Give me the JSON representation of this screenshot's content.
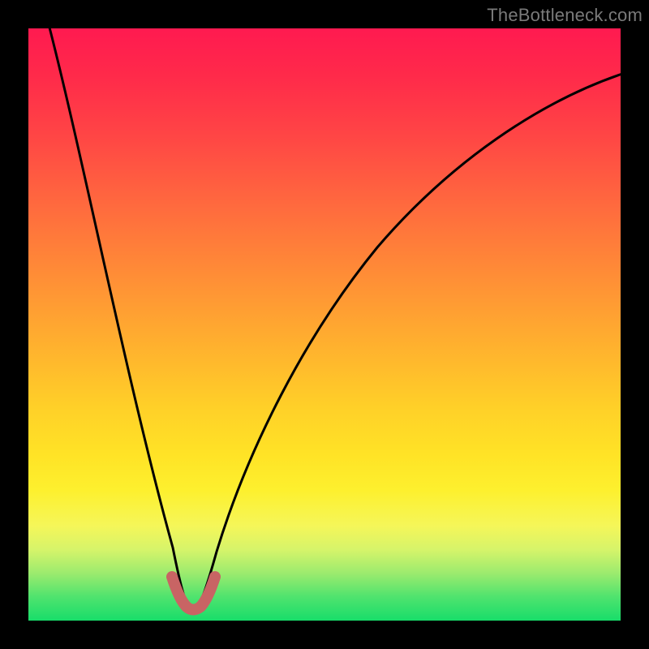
{
  "watermark": "TheBottleneck.com",
  "colors": {
    "frame": "#000000",
    "curve_stroke": "#000000",
    "bump_stroke": "#c86464",
    "gradient_top": "#ff1a50",
    "gradient_bottom": "#18dd6a"
  },
  "chart_data": {
    "type": "line",
    "title": "",
    "xlabel": "",
    "ylabel": "",
    "xlim": [
      0,
      100
    ],
    "ylim": [
      0,
      100
    ],
    "grid": false,
    "legend": false,
    "series": [
      {
        "name": "bottleneck-curve",
        "x": [
          2,
          5,
          8,
          11,
          14,
          17,
          20,
          23,
          25,
          26.5,
          28,
          30,
          33,
          37,
          42,
          48,
          55,
          63,
          72,
          82,
          92,
          100
        ],
        "y": [
          100,
          88,
          76,
          64,
          52,
          40,
          28,
          16,
          6,
          1.5,
          1.5,
          6,
          16,
          28,
          40,
          51,
          61,
          69,
          76,
          82,
          87,
          90
        ]
      },
      {
        "name": "bottleneck-bump",
        "x": [
          24.3,
          25.1,
          26.0,
          27.0,
          28.0,
          29.0,
          29.8,
          30.6
        ],
        "y": [
          6.4,
          4.0,
          2.4,
          1.6,
          1.6,
          2.4,
          4.0,
          6.4
        ]
      }
    ],
    "notch_x": 27.5
  }
}
